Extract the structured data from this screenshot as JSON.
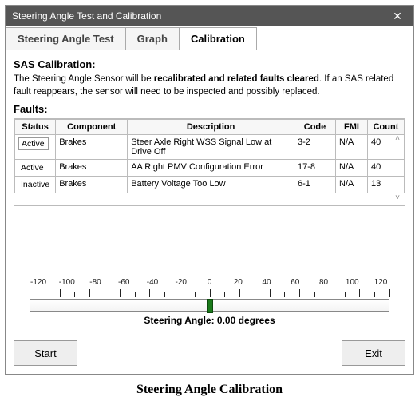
{
  "window": {
    "title": "Steering Angle Test and Calibration"
  },
  "tabs": [
    {
      "label": "Steering Angle Test",
      "active": false
    },
    {
      "label": "Graph",
      "active": false
    },
    {
      "label": "Calibration",
      "active": true
    }
  ],
  "section": {
    "heading": "SAS Calibration:",
    "desc_pre": "The Steering Angle Sensor will be ",
    "desc_bold": "recalibrated and related faults cleared",
    "desc_post": ". If an SAS related fault reappears, the sensor will need to be inspected and possibly replaced."
  },
  "faults": {
    "label": "Faults:",
    "columns": [
      "Status",
      "Component",
      "Description",
      "Code",
      "FMI",
      "Count"
    ],
    "rows": [
      {
        "status": "Active",
        "status_boxed": true,
        "component": "Brakes",
        "description": "Steer Axle Right WSS Signal Low at Drive Off",
        "code": "3-2",
        "fmi": "N/A",
        "count": "40"
      },
      {
        "status": "Active",
        "status_boxed": false,
        "component": "Brakes",
        "description": "AA Right PMV Configuration Error",
        "code": "17-8",
        "fmi": "N/A",
        "count": "40"
      },
      {
        "status": "Inactive",
        "status_boxed": false,
        "component": "Brakes",
        "description": "Battery Voltage Too Low",
        "code": "6-1",
        "fmi": "N/A",
        "count": "13"
      }
    ]
  },
  "gauge": {
    "ticks": [
      "-120",
      "-100",
      "-80",
      "-60",
      "-40",
      "-20",
      "0",
      "20",
      "40",
      "60",
      "80",
      "100",
      "120"
    ],
    "label_prefix": "Steering Angle: ",
    "value_text": "0.00 degrees"
  },
  "buttons": {
    "start": "Start",
    "exit": "Exit"
  },
  "caption": "Steering Angle Calibration"
}
